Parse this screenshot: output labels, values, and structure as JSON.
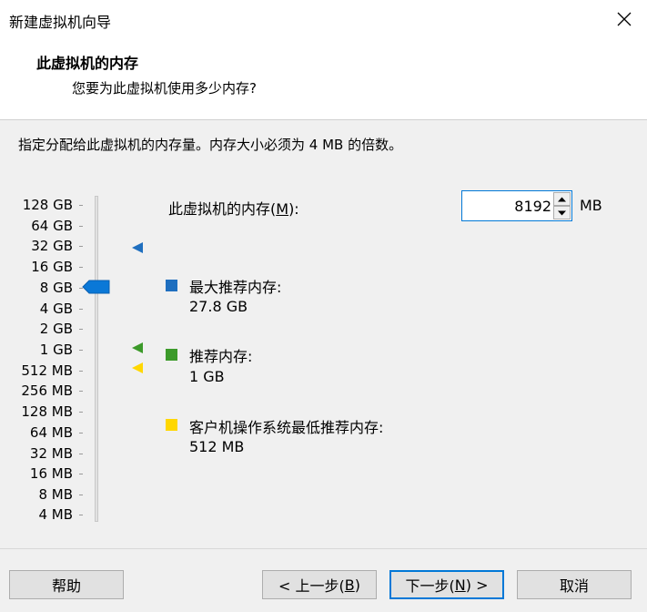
{
  "window": {
    "title": "新建虚拟机向导"
  },
  "header": {
    "heading": "此虚拟机的内存",
    "subheading": "您要为此虚拟机使用多少内存?"
  },
  "instruction": "指定分配给此虚拟机的内存量。内存大小必须为 4 MB 的倍数。",
  "scale": {
    "labels": [
      "128 GB",
      "64 GB",
      "32 GB",
      "16 GB",
      "8 GB",
      "4 GB",
      "2 GB",
      "1 GB",
      "512 MB",
      "256 MB",
      "128 MB",
      "64 MB",
      "32 MB",
      "16 MB",
      "8 MB",
      "4 MB"
    ],
    "current": "8 GB"
  },
  "memory": {
    "label_pre": "此虚拟机的内存(",
    "label_key": "M",
    "label_post": "):",
    "value": "8192",
    "unit": "MB"
  },
  "legend": {
    "max": {
      "title": "最大推荐内存:",
      "value": "27.8 GB",
      "color": "#1f6fbf"
    },
    "recommended": {
      "title": "推荐内存:",
      "value": "1 GB",
      "color": "#3c9a2a"
    },
    "min": {
      "title": "客户机操作系统最低推荐内存:",
      "value": "512 MB",
      "color": "#ffd700"
    }
  },
  "buttons": {
    "help": "帮助",
    "back_pre": "< 上一步(",
    "back_key": "B",
    "back_post": ")",
    "next_pre": "下一步(",
    "next_key": "N",
    "next_post": ") >",
    "cancel": "取消"
  }
}
